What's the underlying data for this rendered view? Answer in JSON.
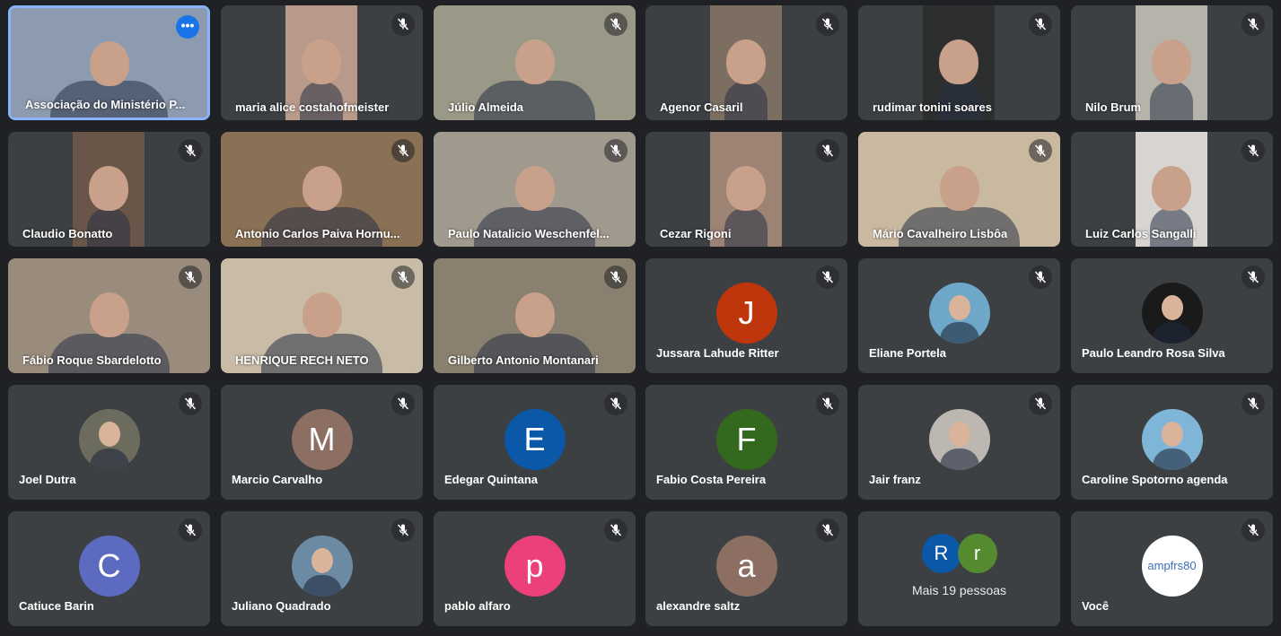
{
  "participants": [
    {
      "name": "Associação do Ministério P...",
      "kind": "video",
      "bg": "#8d9bb0",
      "active": true
    },
    {
      "name": "maria alice costahofmeister",
      "kind": "video",
      "bg": "#b99a8a"
    },
    {
      "name": "Júlio Almeida",
      "kind": "video",
      "bg": "#9a9886"
    },
    {
      "name": "Agenor Casaril",
      "kind": "video",
      "bg": "#7c6e60"
    },
    {
      "name": "rudimar tonini soares",
      "kind": "video",
      "bg": "#2c2f2e"
    },
    {
      "name": "Nilo Brum",
      "kind": "video",
      "bg": "#b5b3aa"
    },
    {
      "name": "Claudio Bonatto",
      "kind": "video",
      "bg": "#6a5648"
    },
    {
      "name": "Antonio Carlos Paiva Hornu...",
      "kind": "video",
      "bg": "#8a7054"
    },
    {
      "name": "Paulo Natalicio Weschenfel...",
      "kind": "video",
      "bg": "#a09a8e"
    },
    {
      "name": "Cezar Rigoni",
      "kind": "video",
      "bg": "#9c8374"
    },
    {
      "name": "Mário Cavalheiro Lisbôa",
      "kind": "video",
      "bg": "#c9b9a0"
    },
    {
      "name": "Luiz Carlos Sangalli",
      "kind": "video",
      "bg": "#d8d4d2"
    },
    {
      "name": "Fábio Roque Sbardelotto",
      "kind": "video",
      "bg": "#9a8c7c"
    },
    {
      "name": "HENRIQUE RECH NETO",
      "kind": "video",
      "bg": "#c8bca6"
    },
    {
      "name": "Gilberto Antonio Montanari",
      "kind": "video",
      "bg": "#8a8070"
    },
    {
      "name": "Jussara Lahude Ritter",
      "kind": "avatar",
      "letter": "J",
      "color": "#c0360c"
    },
    {
      "name": "Eliane Portela",
      "kind": "photo",
      "color": "#6fa7c8"
    },
    {
      "name": "Paulo Leandro Rosa Silva",
      "kind": "photo",
      "color": "#1a1a1a"
    },
    {
      "name": "Joel Dutra",
      "kind": "photo",
      "color": "#6b6b5e"
    },
    {
      "name": "Marcio Carvalho",
      "kind": "avatar",
      "letter": "M",
      "color": "#8d6e63"
    },
    {
      "name": "Edegar Quintana",
      "kind": "avatar",
      "letter": "E",
      "color": "#0b57a8"
    },
    {
      "name": "Fabio Costa Pereira",
      "kind": "avatar",
      "letter": "F",
      "color": "#33691e"
    },
    {
      "name": "Jair franz",
      "kind": "photo",
      "color": "#bdb7b1"
    },
    {
      "name": "Caroline Spotorno agenda",
      "kind": "photo",
      "color": "#7fb6d8"
    },
    {
      "name": "Catiuce Barin",
      "kind": "avatar",
      "letter": "C",
      "color": "#5c6bc0"
    },
    {
      "name": "Juliano Quadrado",
      "kind": "photo",
      "color": "#6c8aa3"
    },
    {
      "name": "pablo alfaro",
      "kind": "avatar",
      "letter": "p",
      "color": "#ec407a"
    },
    {
      "name": "alexandre saltz",
      "kind": "avatar",
      "letter": "a",
      "color": "#8d6e63"
    },
    {
      "name": "Mais 19 pessoas",
      "kind": "more",
      "minis": [
        {
          "letter": "R",
          "color": "#0b57a8"
        },
        {
          "letter": "r",
          "color": "#558b2f"
        }
      ]
    },
    {
      "name": "Você",
      "kind": "logo",
      "color": "#ffffff",
      "logo_text": "ampfrs80"
    }
  ]
}
